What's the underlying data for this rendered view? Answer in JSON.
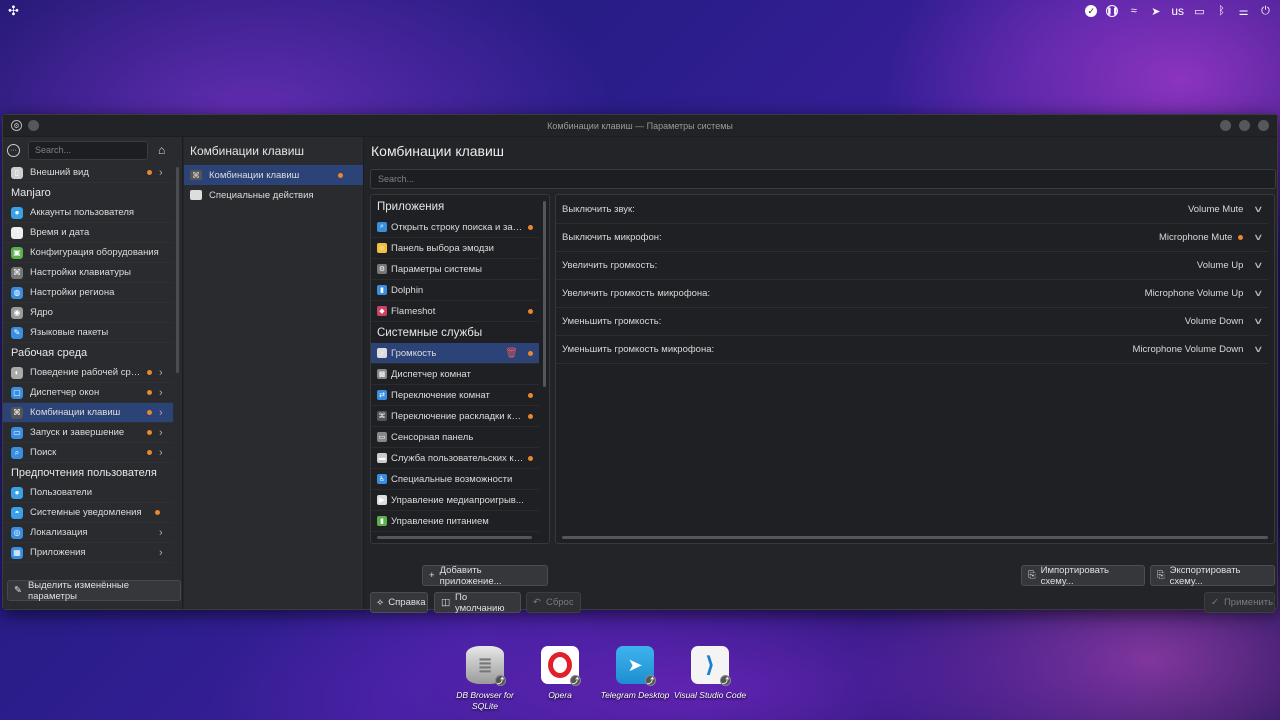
{
  "topbar": {
    "tray_icons": [
      "check-circle-icon",
      "pause-circle-icon",
      "flame-icon",
      "telegram-icon",
      "keyboard-layout-label",
      "display-icon",
      "bluetooth-icon",
      "settings-toggle-icon",
      "power-icon"
    ],
    "keyboard_layout": "us"
  },
  "window": {
    "title": "Комбинации клавиш — Параметры системы"
  },
  "sidebar": {
    "search_placeholder": "Search...",
    "items": [
      {
        "label": "Внешний вид",
        "icon": "brush-icon",
        "color": "#cfcfcf",
        "changed": true,
        "chevron": true
      },
      {
        "header": "Manjaro"
      },
      {
        "label": "Аккаунты пользователя",
        "icon": "user-icon",
        "color": "#3aa0e8"
      },
      {
        "label": "Время и дата",
        "icon": "clock-icon",
        "color": "#eeeeee"
      },
      {
        "label": "Конфигурация оборудования",
        "icon": "hardware-icon",
        "color": "#5ab04a"
      },
      {
        "label": "Настройки клавиатуры",
        "icon": "keyboard-icon",
        "color": "#777777"
      },
      {
        "label": "Настройки региона",
        "icon": "globe-icon",
        "color": "#3a8ee0"
      },
      {
        "label": "Ядро",
        "icon": "kernel-icon",
        "color": "#9a9a9a"
      },
      {
        "label": "Языковые пакеты",
        "icon": "language-icon",
        "color": "#3a8ee0"
      },
      {
        "header": "Рабочая среда"
      },
      {
        "label": "Поведение рабочей сре...",
        "icon": "desktop-icon",
        "color": "#aaaaaa",
        "changed": true,
        "chevron": true
      },
      {
        "label": "Диспетчер окон",
        "icon": "window-icon",
        "color": "#3a8ee0",
        "changed": true,
        "chevron": true
      },
      {
        "label": "Комбинации клавиш",
        "icon": "shortcuts-icon",
        "color": "#555555",
        "changed": true,
        "chevron": true,
        "active": true
      },
      {
        "label": "Запуск и завершение",
        "icon": "startup-icon",
        "color": "#3a8ee0",
        "changed": true,
        "chevron": true
      },
      {
        "label": "Поиск",
        "icon": "search-icon",
        "color": "#3a8ee0",
        "changed": true,
        "chevron": true
      },
      {
        "header": "Предпочтения пользователя"
      },
      {
        "label": "Пользователи",
        "icon": "users-icon",
        "color": "#3aa0e8"
      },
      {
        "label": "Системные уведомления",
        "icon": "notification-icon",
        "color": "#3aa0e8",
        "changed": true
      },
      {
        "label": "Локализация",
        "icon": "locale-icon",
        "color": "#3a8ee0",
        "chevron": true
      },
      {
        "label": "Приложения",
        "icon": "apps-icon",
        "color": "#3a8ee0",
        "chevron": true
      }
    ],
    "highlight_button": "Выделить изменённые параметры"
  },
  "subpanel": {
    "title": "Комбинации клавиш",
    "items": [
      {
        "label": "Комбинации клавиш",
        "active": true,
        "changed": true
      },
      {
        "label": "Специальные действия"
      }
    ]
  },
  "main": {
    "title": "Комбинации клавиш",
    "search_placeholder": "Search...",
    "components": [
      {
        "group": "Приложения"
      },
      {
        "label": "Открыть строку поиска и зап...",
        "icon": "krunner-icon",
        "color": "#3a8ee0",
        "changed": true
      },
      {
        "label": "Панель выбора эмодзи",
        "icon": "emoji-icon",
        "color": "#f0c040"
      },
      {
        "label": "Параметры системы",
        "icon": "settings-icon",
        "color": "#777777"
      },
      {
        "label": "Dolphin",
        "icon": "dolphin-icon",
        "color": "#3a8ee0"
      },
      {
        "label": "Flameshot",
        "icon": "flameshot-icon",
        "color": "#d04060",
        "changed": true
      },
      {
        "group": "Системные службы"
      },
      {
        "label": "Громкость",
        "icon": "volume-icon",
        "color": "#dddddd",
        "changed": true,
        "active": true
      },
      {
        "label": "Диспетчер комнат",
        "icon": "activities-icon",
        "color": "#888888"
      },
      {
        "label": "Переключение комнат",
        "icon": "switch-icon",
        "color": "#3a8ee0",
        "changed": true
      },
      {
        "label": "Переключение раскладки кл...",
        "icon": "layout-icon",
        "color": "#555555",
        "changed": true
      },
      {
        "label": "Сенсорная панель",
        "icon": "touchpad-icon",
        "color": "#888888"
      },
      {
        "label": "Служба пользовательских ко...",
        "icon": "service-icon",
        "color": "#cccccc",
        "changed": true
      },
      {
        "label": "Специальные возможности",
        "icon": "accessibility-icon",
        "color": "#3a8ee0"
      },
      {
        "label": "Управление медиапроигрыв...",
        "icon": "media-icon",
        "color": "#dddddd"
      },
      {
        "label": "Управление питанием",
        "icon": "battery-icon",
        "color": "#5ab04a"
      }
    ],
    "shortcuts": [
      {
        "action": "Выключить звук:",
        "key": "Volume Mute"
      },
      {
        "action": "Выключить микрофон:",
        "key": "Microphone Mute",
        "changed": true
      },
      {
        "action": "Увеличить громкость:",
        "key": "Volume Up"
      },
      {
        "action": "Увеличить громкость микрофона:",
        "key": "Microphone Volume Up"
      },
      {
        "action": "Уменьшить громкость:",
        "key": "Volume Down"
      },
      {
        "action": "Уменьшить громкость микрофона:",
        "key": "Microphone Volume Down"
      }
    ],
    "buttons": {
      "add_app": "Добавить приложение...",
      "import": "Импортировать схему...",
      "export": "Экспортировать схему...",
      "help": "Справка",
      "defaults": "По умолчанию",
      "reset": "Сброс",
      "apply": "Применить"
    }
  },
  "dock": [
    {
      "label": "DB Browser for SQLite",
      "icon": "database-icon"
    },
    {
      "label": "Opera",
      "icon": "opera-icon"
    },
    {
      "label": "Telegram Desktop",
      "icon": "telegram-icon"
    },
    {
      "label": "Visual Studio Code",
      "icon": "vscode-icon"
    }
  ]
}
